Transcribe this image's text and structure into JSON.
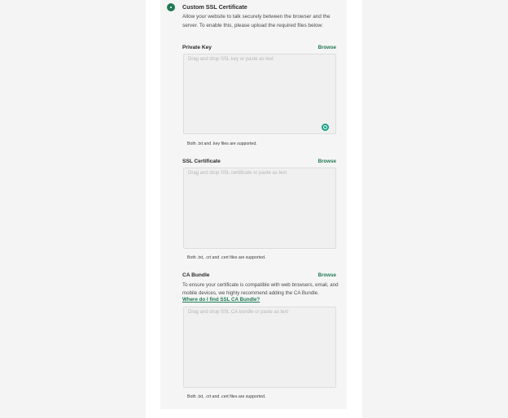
{
  "section": {
    "title": "Custom SSL Certificate",
    "description": "Allow your website to talk securely between the browser and the server. To enable this, please upload the required files below:"
  },
  "private_key": {
    "label": "Private Key",
    "browse": "Browse",
    "placeholder": "Drag and drop SSL key or paste as text",
    "hint": "Both .txt and .key files are supported."
  },
  "ssl_certificate": {
    "label": "SSL Certificate",
    "browse": "Browse",
    "placeholder": "Drag and drop SSL certificate or paste as text",
    "hint": "Both .txt, .crt and .cert files are supported."
  },
  "ca_bundle": {
    "label": "CA Bundle",
    "browse": "Browse",
    "description": "To ensure your certificate is compatible with web browsers, email, and mobile devices, we highly recommend adding the CA Bundle.",
    "help_link": "Where do I find SSL CA Bundle?",
    "placeholder": "Drag and drop SSL CA bundle or paste as text",
    "hint": "Both .txt, .crt and .cert files are supported."
  },
  "icons": {
    "radio": "radio-selected-icon",
    "assistant": "grammarly-icon"
  },
  "colors": {
    "accent": "#1f7a55",
    "panel": "#f5f5f5",
    "page": "#f4f4f4"
  }
}
